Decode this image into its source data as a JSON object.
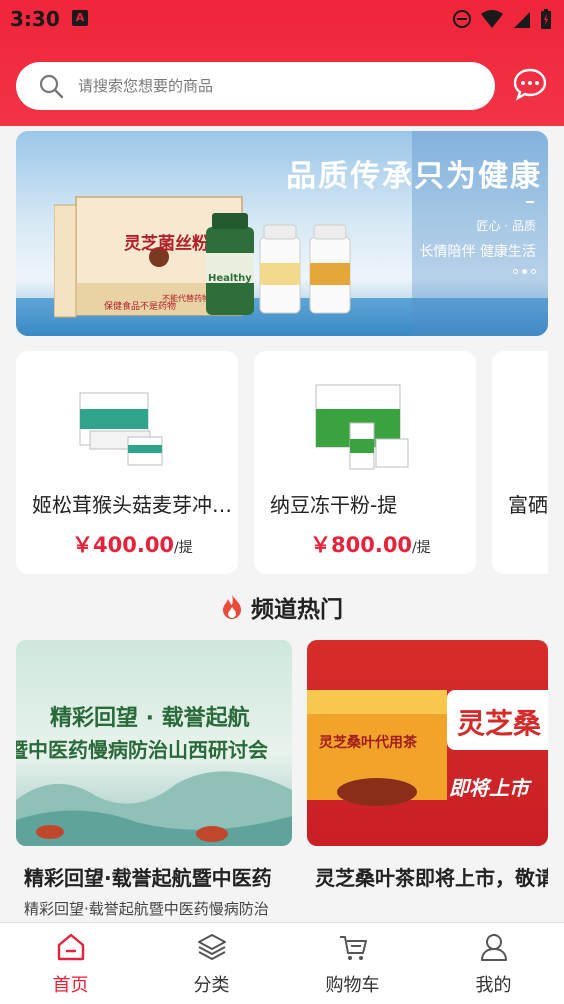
{
  "status_bar": {
    "time": "3:30",
    "notification_icon": "A"
  },
  "search": {
    "placeholder": "请搜索您想要的商品"
  },
  "banner": {
    "title": "品质传承只为健康",
    "sub1": "匠心 · 品质",
    "sub2": "长情陪伴 健康生活",
    "box_label": "灵芝菌丝粉",
    "box_caption": "保健食品不是药物",
    "box_caption2": "不能代替药物治疗",
    "bottle_label": "Healthy"
  },
  "products": [
    {
      "name": "姬松茸猴头菇麦芽冲剂-提",
      "price": "￥400.00",
      "unit": "/提"
    },
    {
      "name": "纳豆冻干粉-提",
      "price": "￥800.00",
      "unit": "/提"
    },
    {
      "name": "富硒",
      "price": "",
      "unit": ""
    }
  ],
  "section": {
    "title": "频道热门"
  },
  "news": [
    {
      "image_title": "精彩回望 · 载誉起航",
      "image_subtitle": "暨中医药慢病防治山西研讨会",
      "title": "精彩回望·载誉起航暨中医药",
      "subtitle": "精彩回望·载誉起航暨中医药慢病防治"
    },
    {
      "image_title": "灵芝桑叶代用茶",
      "image_subtitle": "即将上市",
      "image_right": "灵芝桑",
      "title": "灵芝桑叶茶即将上市，敬请",
      "subtitle": ""
    }
  ],
  "tabs": [
    {
      "label": "首页",
      "icon": "home-icon",
      "active": true
    },
    {
      "label": "分类",
      "icon": "layers-icon",
      "active": false
    },
    {
      "label": "购物车",
      "icon": "cart-icon",
      "active": false
    },
    {
      "label": "我的",
      "icon": "user-icon",
      "active": false
    }
  ],
  "colors": {
    "brand": "#f0243a",
    "price": "#e6233a"
  }
}
